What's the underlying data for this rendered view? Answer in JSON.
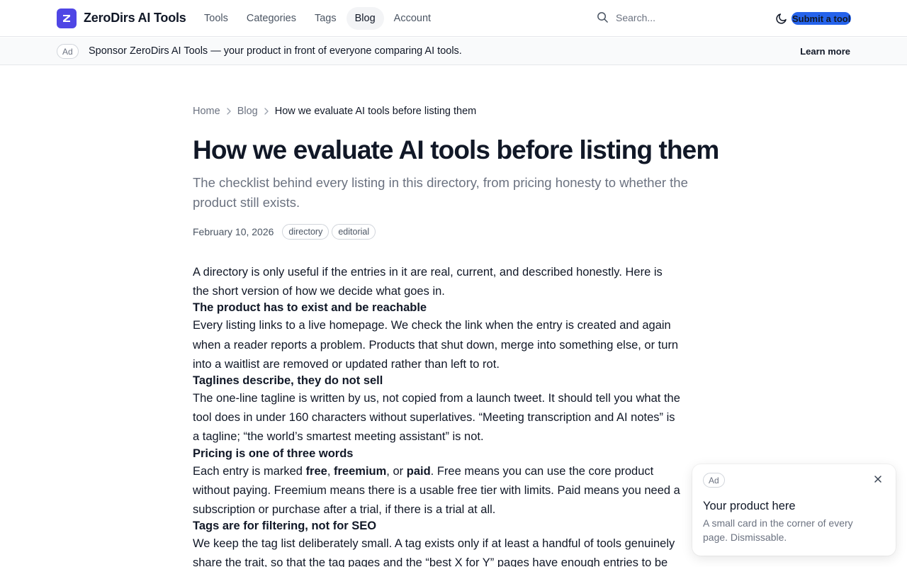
{
  "header": {
    "brand": "ZeroDirs AI Tools",
    "logo_letter": "Z",
    "nav": [
      {
        "label": "Tools",
        "active": false
      },
      {
        "label": "Categories",
        "active": false
      },
      {
        "label": "Tags",
        "active": false
      },
      {
        "label": "Blog",
        "active": true
      },
      {
        "label": "Account",
        "active": false
      }
    ],
    "search_placeholder": "Search...",
    "theme_icon": "moon-icon",
    "submit_label": "Submit a tool"
  },
  "sponsor_bar": {
    "badge": "Ad",
    "text": "Sponsor ZeroDirs AI Tools — your product in front of everyone comparing AI tools.",
    "link": "Learn more"
  },
  "article": {
    "breadcrumb": [
      "Home",
      "Blog",
      "How we evaluate AI tools before listing them"
    ],
    "title": "How we evaluate AI tools before listing them",
    "subtitle": "The checklist behind every listing in this directory, from pricing honesty to whether the product still exists.",
    "date": "February 10, 2026",
    "tags": [
      "directory",
      "editorial"
    ],
    "intro": "A directory is only useful if the entries in it are real, current, and described honestly. Here is the short version of how we decide what goes in.",
    "sections": [
      {
        "heading": "The product has to exist and be reachable",
        "text": "Every listing links to a live homepage. We check the link when the entry is created and again when a reader reports a problem. Products that shut down, merge into something else, or turn into a waitlist are removed or updated rather than left to rot."
      },
      {
        "heading": "Taglines describe, they do not sell",
        "text": "The one-line tagline is written by us, not copied from a launch tweet. It should tell you what the tool does in under 160 characters without superlatives. “Meeting transcription and AI notes” is a tagline; “the world’s smartest meeting assistant” is not."
      },
      {
        "heading": "Pricing is one of three words",
        "text_parts": {
          "before": "Each entry is marked ",
          "free": "free",
          "comma1": ", ",
          "freemium": "freemium",
          "or": ", or ",
          "paid": "paid",
          "after": ". Free means you can use the core product without paying. Freemium means there is a usable free tier with limits. Paid means you need a subscription or purchase after a trial, if there is a trial at all."
        }
      },
      {
        "heading": "Tags are for filtering, not for SEO",
        "text": "We keep the tag list deliberately small. A tag exists only if at least a handful of tools genuinely share the trait, so that the tag pages and the “best X for Y” pages have enough entries to be"
      }
    ]
  },
  "corner_ad": {
    "badge": "Ad",
    "title": "Your product here",
    "description": "A small card in the corner of every page. Dismissable.",
    "close_icon": "close-icon"
  }
}
